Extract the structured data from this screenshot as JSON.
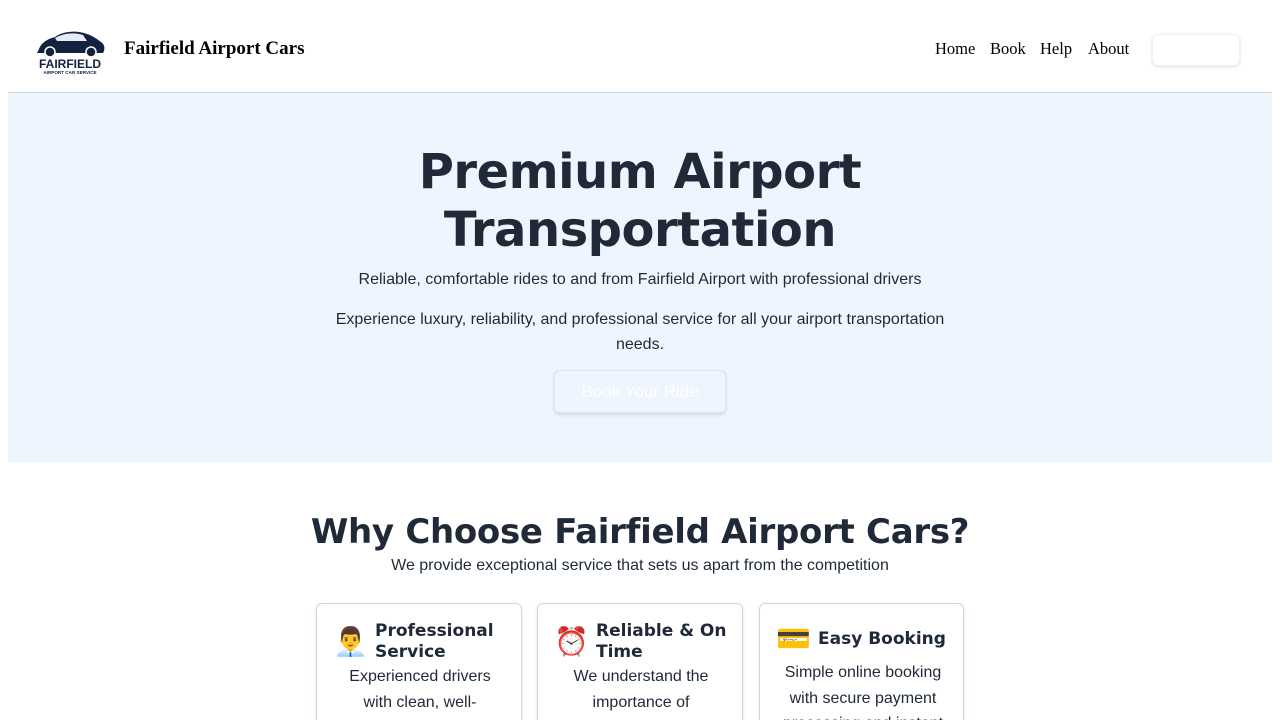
{
  "header": {
    "brand_name": "Fairfield Airport Cars",
    "logo": {
      "icon": "car-logo-icon",
      "wordmark": "FAIRFIELD",
      "tagline": "AIRPORT CAR SERVICE",
      "color": "#13233f"
    },
    "nav": {
      "home": "Home",
      "book": "Book",
      "help": "Help",
      "about": "About"
    },
    "action_button_label": ""
  },
  "hero": {
    "title_line1": "Premium Airport",
    "title_line2": "Transportation",
    "subtitle": "Reliable, comfortable rides to and from Fairfield Airport with professional drivers",
    "description": "Experience luxury, reliability, and professional service for all your airport transportation needs.",
    "cta_label": "Book Your Ride",
    "background": "#eef5ff"
  },
  "features": {
    "title": "Why Choose Fairfield Airport Cars?",
    "subtitle": "We provide exceptional service that sets us apart from the competition",
    "cards": [
      {
        "icon": "driver-icon",
        "emoji": "👨‍💼",
        "title": "Professional Service",
        "text": "Experienced drivers with clean, well-"
      },
      {
        "icon": "alarm-clock-icon",
        "emoji": "⏰",
        "title": "Reliable & On Time",
        "text": "We understand the importance of"
      },
      {
        "icon": "credit-card-icon",
        "emoji": "💳",
        "title": "Easy Booking",
        "text": "Simple online booking with secure payment processing and instant"
      }
    ]
  },
  "colors": {
    "text": "#1f2937",
    "border": "#cbd5e1"
  }
}
